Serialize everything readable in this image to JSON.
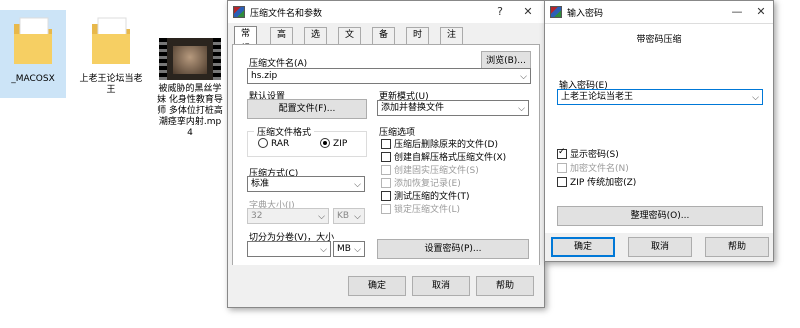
{
  "desktop": {
    "items": [
      {
        "label": "_MACOSX"
      },
      {
        "label": "上老王论坛当老王"
      },
      {
        "label": "被威胁的黑丝学妹 化身性教育导师 多体位打桩高潮痉挛内射.mp4"
      }
    ]
  },
  "archive_dialog": {
    "title": "压缩文件名和参数",
    "help_glyph": "?",
    "close_glyph": "✕",
    "tabs": [
      "常规",
      "高级",
      "选项",
      "文件",
      "备份",
      "时间",
      "注释"
    ],
    "filename_label": "压缩文件名(A)",
    "browse_button": "浏览(B)...",
    "filename_value": "hs.zip",
    "default_settings_label": "默认设置",
    "profiles_button": "配置文件(F)...",
    "update_mode_label": "更新模式(U)",
    "update_mode_value": "添加并替换文件",
    "format_group": "压缩文件格式",
    "format_rar": "RAR",
    "format_zip": "ZIP",
    "method_label": "压缩方式(C)",
    "method_value": "标准",
    "dict_label": "字典大小(I)",
    "dict_value": "32",
    "dict_unit": "KB",
    "split_label": "切分为分卷(V)，大小",
    "split_value": "",
    "split_unit": "MB",
    "options_group": "压缩选项",
    "options": [
      {
        "label": "压缩后删除原来的文件(D)",
        "checked": false,
        "disabled": false
      },
      {
        "label": "创建自解压格式压缩文件(X)",
        "checked": false,
        "disabled": false
      },
      {
        "label": "创建固实压缩文件(S)",
        "checked": false,
        "disabled": true
      },
      {
        "label": "添加恢复记录(E)",
        "checked": false,
        "disabled": true
      },
      {
        "label": "测试压缩的文件(T)",
        "checked": false,
        "disabled": false
      },
      {
        "label": "锁定压缩文件(L)",
        "checked": false,
        "disabled": true
      }
    ],
    "set_password_button": "设置密码(P)...",
    "ok_button": "确定",
    "cancel_button": "取消",
    "help_button": "帮助"
  },
  "password_dialog": {
    "title": "输入密码",
    "minimize_glyph": "—",
    "close_glyph": "✕",
    "heading": "带密码压缩",
    "password_label": "输入密码(E)",
    "password_value": "上老王论坛当老王",
    "show_password": "显示密码(S)",
    "encrypt_names": "加密文件名(N)",
    "zip_legacy": "ZIP 传统加密(Z)",
    "organize_button": "整理密码(O)...",
    "ok_button": "确定",
    "cancel_button": "取消",
    "help_button": "帮助"
  }
}
